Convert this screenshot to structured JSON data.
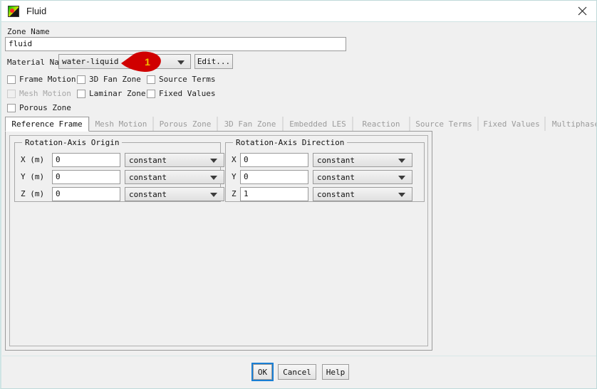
{
  "window": {
    "title": "Fluid",
    "icon": "fluent-app-icon",
    "close_icon": "close-icon"
  },
  "zone": {
    "label": "Zone Name",
    "value": "fluid",
    "placeholder": ""
  },
  "material": {
    "label": "Material Name",
    "value": "water-liquid",
    "edit_label": "Edit...",
    "dropdown_icon": "chevron-down-icon"
  },
  "annotation": {
    "number": "1",
    "color": "#d00000",
    "text_color": "#f2c200"
  },
  "options": [
    {
      "label": "Frame Motion",
      "checked": false,
      "disabled": false
    },
    {
      "label": "3D Fan Zone",
      "checked": false,
      "disabled": false
    },
    {
      "label": "Source Terms",
      "checked": false,
      "disabled": false
    },
    {
      "label": "Mesh Motion",
      "checked": false,
      "disabled": true
    },
    {
      "label": "Laminar Zone",
      "checked": false,
      "disabled": false
    },
    {
      "label": "Fixed Values",
      "checked": false,
      "disabled": false
    },
    {
      "label": "Porous Zone",
      "checked": false,
      "disabled": false
    }
  ],
  "tabs": [
    {
      "label": "Reference Frame",
      "active": true
    },
    {
      "label": "Mesh Motion",
      "active": false
    },
    {
      "label": "Porous Zone",
      "active": false
    },
    {
      "label": "3D Fan Zone",
      "active": false
    },
    {
      "label": "Embedded LES",
      "active": false
    },
    {
      "label": "Reaction",
      "active": false
    },
    {
      "label": "Source Terms",
      "active": false
    },
    {
      "label": "Fixed Values",
      "active": false
    },
    {
      "label": "Multiphase",
      "active": false
    }
  ],
  "reference_frame": {
    "origin": {
      "title": "Rotation-Axis Origin",
      "rows": [
        {
          "label": "X (m)",
          "value": "0",
          "mode": "constant"
        },
        {
          "label": "Y (m)",
          "value": "0",
          "mode": "constant"
        },
        {
          "label": "Z (m)",
          "value": "0",
          "mode": "constant"
        }
      ]
    },
    "direction": {
      "title": "Rotation-Axis Direction",
      "rows": [
        {
          "label": "X",
          "value": "0",
          "mode": "constant"
        },
        {
          "label": "Y",
          "value": "0",
          "mode": "constant"
        },
        {
          "label": "Z",
          "value": "1",
          "mode": "constant"
        }
      ]
    }
  },
  "buttons": {
    "ok": "OK",
    "cancel": "Cancel",
    "help": "Help"
  },
  "colors": {
    "focus_outline": "#1a7fd4",
    "window_bg": "#f0f0f0",
    "titlebar_bg": "#ffffff",
    "accent_border": "#cfe5e5"
  }
}
